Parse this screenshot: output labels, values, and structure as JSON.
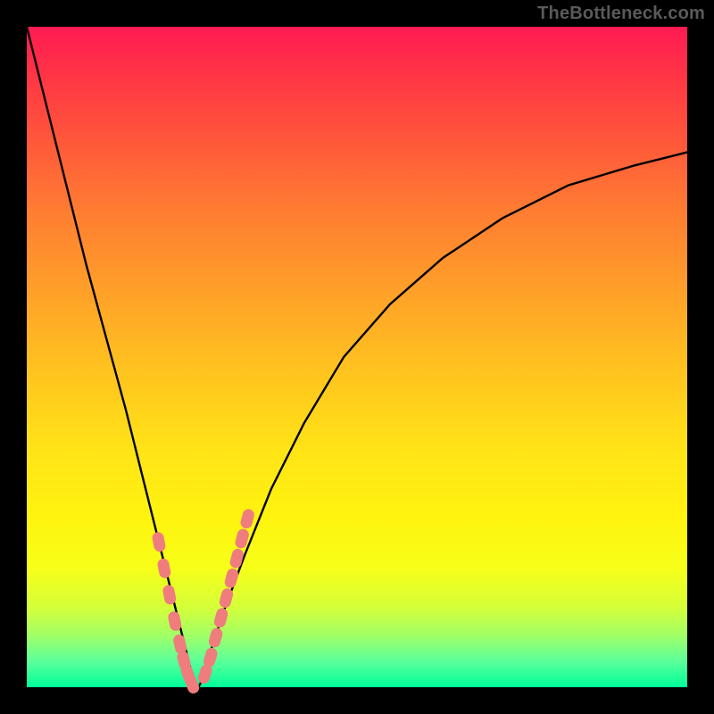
{
  "watermark": "TheBottleneck.com",
  "colors": {
    "frame": "#000000",
    "curve_stroke": "#000000",
    "marker_fill": "#ef7d7d",
    "marker_stroke": "#c95f5f"
  },
  "chart_data": {
    "type": "line",
    "title": "",
    "xlabel": "",
    "ylabel": "",
    "xlim": [
      0,
      100
    ],
    "ylim": [
      0,
      100
    ],
    "grid": false,
    "legend": false,
    "series": [
      {
        "name": "bottleneck-curve",
        "x": [
          0,
          3,
          6,
          9,
          12,
          15,
          17,
          19,
          21,
          22.5,
          24,
          25,
          26,
          27,
          28,
          30,
          33,
          37,
          42,
          48,
          55,
          63,
          72,
          82,
          92,
          100
        ],
        "y": [
          100,
          88,
          76,
          64,
          53,
          42,
          34,
          26,
          18,
          12,
          6,
          2,
          0,
          2,
          6,
          12,
          20,
          30,
          40,
          50,
          58,
          65,
          71,
          76,
          79,
          81
        ]
      }
    ],
    "markers": {
      "name": "highlight-points",
      "x_left": [
        20.0,
        20.8,
        21.6,
        22.4,
        23.2,
        23.8,
        24.4,
        25.0
      ],
      "y_left": [
        22.0,
        18.0,
        14.0,
        10.0,
        6.5,
        4.0,
        2.0,
        0.5
      ],
      "x_right": [
        27.0,
        27.8,
        28.6,
        29.4,
        30.2,
        31.0,
        31.8,
        32.6,
        33.4
      ],
      "y_right": [
        2.0,
        4.5,
        7.5,
        10.5,
        13.5,
        16.5,
        19.5,
        22.5,
        25.5
      ]
    }
  }
}
